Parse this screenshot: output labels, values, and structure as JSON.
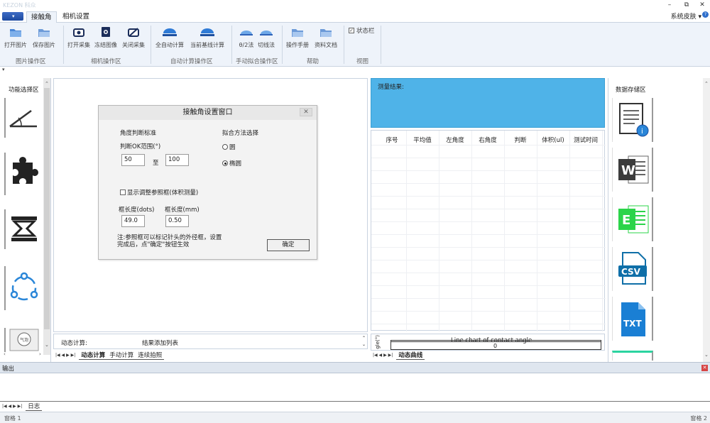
{
  "window": {
    "title": "KEZON 科众",
    "minimize": "–",
    "restore": "⧉",
    "close": "✕"
  },
  "tabs": [
    "接触角",
    "相机设置"
  ],
  "skin": "系统皮肤 ▾",
  "ribbon": {
    "groups": [
      {
        "label": "图片操作区",
        "buttons": [
          "打开图片",
          "保存图片"
        ]
      },
      {
        "label": "相机操作区",
        "buttons": [
          "打开采集",
          "冻结图像",
          "关闭采集"
        ]
      },
      {
        "label": "自动计算操作区",
        "buttons": [
          "全自动计算",
          "当前基线计算"
        ]
      },
      {
        "label": "手动拟合操作区",
        "buttons": [
          "θ/2法",
          "切线法"
        ]
      },
      {
        "label": "帮助",
        "buttons": [
          "操作手册",
          "资料文档"
        ]
      },
      {
        "label": "视图",
        "buttons": []
      }
    ],
    "status_checkbox": "状态栏"
  },
  "left_panel": {
    "title": "功能选择区"
  },
  "dialog": {
    "title": "接触角设置窗口",
    "angle_standard": "角度判断标准",
    "ok_range_label": "判断OK范围(°)",
    "range_min": "50",
    "range_to": "至",
    "range_max": "100",
    "fit_method_label": "拟合方法选择",
    "fit_options": [
      "圆",
      "椭圆"
    ],
    "fit_selected": "椭圆",
    "show_frame_label": "显示调整参照框(体积测量)",
    "frame_len_dots_label": "框长度(dots)",
    "frame_len_mm_label": "框长度(mm)",
    "frame_len_dots": "49.0",
    "frame_len_mm": "0.50",
    "note": "注:参照框可以标记针头的外径框，设置完成后，点\"确定\"按钮生效",
    "ok_button": "确定"
  },
  "calc_strip": {
    "label": "动态计算:",
    "result": "结果添加列表"
  },
  "center_tabs": [
    "动态计算",
    "手动计算",
    "连续拍照"
  ],
  "measure": {
    "label": "测量结果:"
  },
  "table": {
    "headers": [
      "序号",
      "平均值",
      "左角度",
      "右角度",
      "判断",
      "体积(ul)",
      "测试时间"
    ]
  },
  "chart": {
    "title": "Line chart of contact angle",
    "value": "0",
    "axis_label": "gle(°)"
  },
  "right_tabs": [
    "动态曲线"
  ],
  "storage": {
    "title": "数据存储区",
    "icons": [
      "info-doc",
      "word",
      "excel",
      "csv",
      "txt"
    ],
    "word_text": "W",
    "excel_text": "E",
    "csv_text": "CSV",
    "txt_text": "TXT"
  },
  "output": {
    "label": "输出"
  },
  "log_tabs": [
    "日志"
  ],
  "statusbar": {
    "left": "窗格 1",
    "right": "窗格 2"
  },
  "icon_labels": {
    "stamp": "气泡"
  }
}
